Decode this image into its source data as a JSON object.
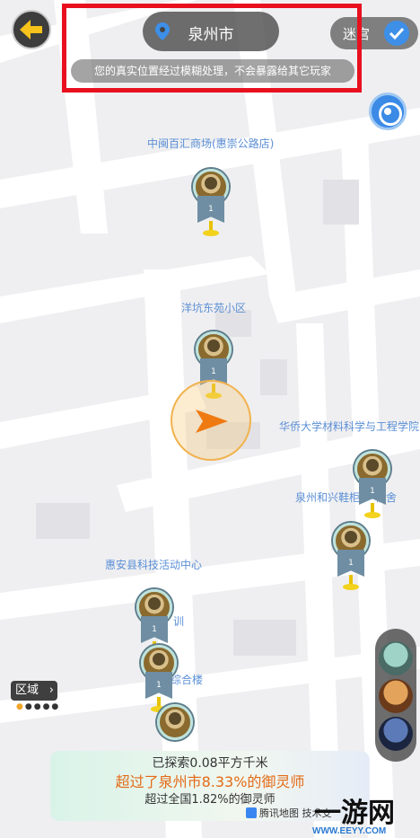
{
  "header": {
    "city": "泉州市",
    "privacy_note": "您的真实位置经过模糊处理，不会暴露给其它玩家",
    "maze_label": "迷宫"
  },
  "map": {
    "pois": [
      "中闽百汇商场(惠崇公路店)",
      "洋坑东苑小区",
      "华侨大学材料科学与工程学院",
      "泉州和兴鞋柜",
      "宿舍",
      "惠安县科技活动中心",
      "训",
      "综合楼"
    ],
    "pin_count": [
      "1",
      "1",
      "1",
      "1",
      "1",
      "1"
    ]
  },
  "region": {
    "label": "区域"
  },
  "stats": {
    "explored": "已探索0.08平方千米",
    "city_rank": "超过了泉州市8.33%的御灵师",
    "national_rank": "超过全国1.82%的御灵师",
    "map_provider": "腾讯地图 技术支"
  },
  "watermark": {
    "logo": "一游网",
    "url": "WWW.EEYY.COM"
  },
  "colors": {
    "highlight": "#e8101f",
    "accent": "#3d8fe8",
    "orange": "#e36a16"
  }
}
